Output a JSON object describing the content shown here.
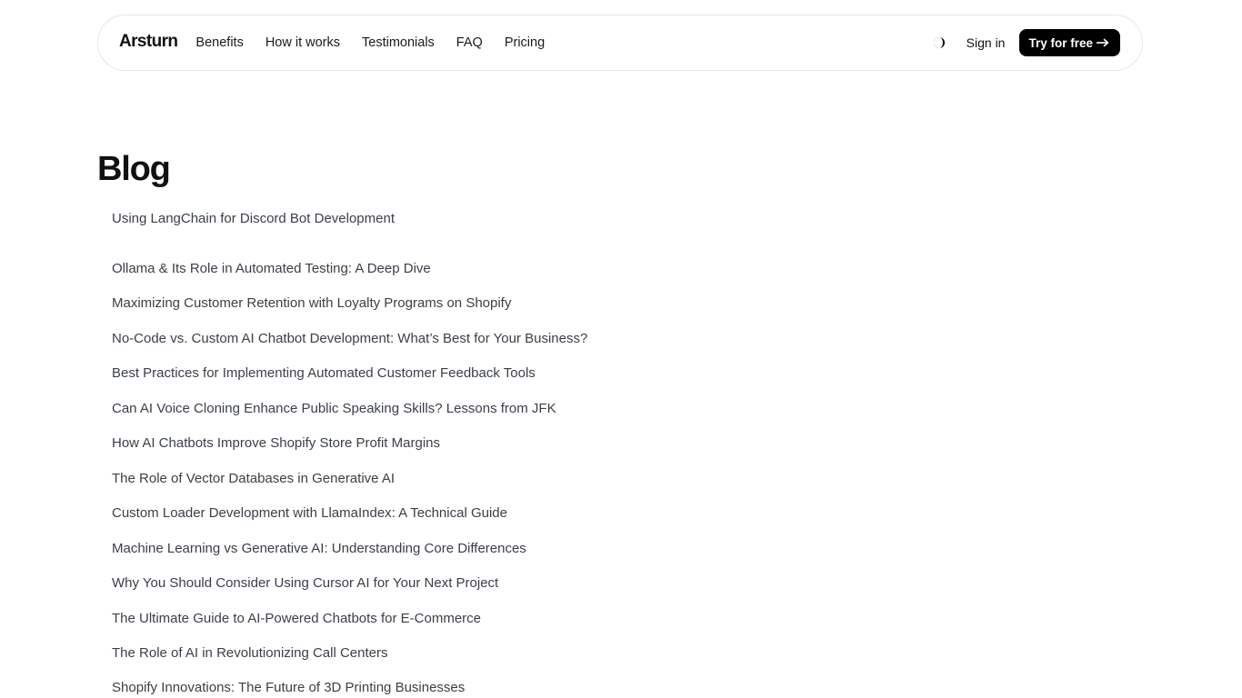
{
  "nav": {
    "brand": "Arsturn",
    "links": [
      "Benefits",
      "How it works",
      "Testimonials",
      "FAQ",
      "Pricing"
    ],
    "theme_toggle_icon": "half-moon-icon",
    "sign_in": "Sign in",
    "cta_label": "Try for free",
    "cta_icon": "arrow-right-icon"
  },
  "page": {
    "title": "Blog"
  },
  "posts": [
    "Using LangChain for Discord Bot Development",
    "Ollama & Its Role in Automated Testing: A Deep Dive",
    "Maximizing Customer Retention with Loyalty Programs on Shopify",
    "No-Code vs. Custom AI Chatbot Development: What’s Best for Your Business?",
    "Best Practices for Implementing Automated Customer Feedback Tools",
    "Can AI Voice Cloning Enhance Public Speaking Skills? Lessons from JFK",
    "How AI Chatbots Improve Shopify Store Profit Margins",
    "The Role of Vector Databases in Generative AI",
    "Custom Loader Development with LlamaIndex: A Technical Guide",
    "Machine Learning vs Generative AI: Understanding Core Differences",
    "Why You Should Consider Using Cursor AI for Your Next Project",
    "The Ultimate Guide to AI-Powered Chatbots for E-Commerce",
    "The Role of AI in Revolutionizing Call Centers",
    "Shopify Innovations: The Future of 3D Printing Businesses"
  ]
}
